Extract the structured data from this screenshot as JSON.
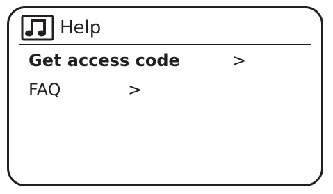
{
  "header": {
    "title": "Help",
    "icon": "music-note-icon"
  },
  "menu": {
    "items": [
      {
        "label": "Get access code",
        "arrow": ">",
        "selected": true
      },
      {
        "label": "FAQ",
        "arrow": ">",
        "selected": false
      }
    ]
  },
  "colors": {
    "foreground": "#231f20",
    "background": "#ffffff"
  }
}
